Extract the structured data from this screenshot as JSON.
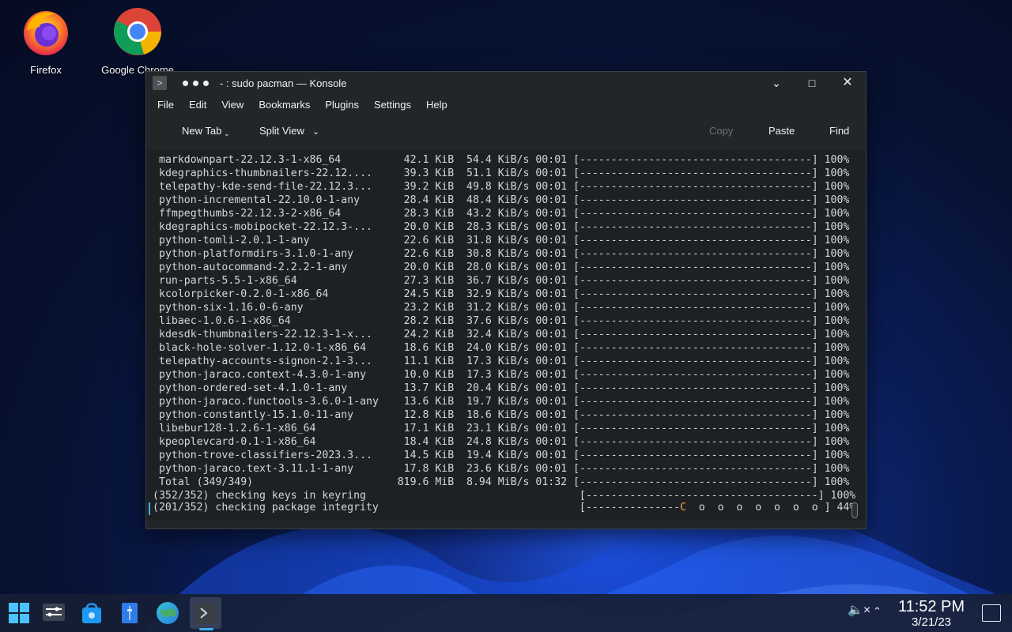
{
  "desktop": {
    "icons": [
      {
        "label": "Firefox"
      },
      {
        "label": "Google Chrome"
      }
    ]
  },
  "window": {
    "title": "- : sudo pacman — Konsole",
    "menu": [
      "File",
      "Edit",
      "View",
      "Bookmarks",
      "Plugins",
      "Settings",
      "Help"
    ],
    "toolbar": {
      "new_tab": "New Tab",
      "split_view": "Split View",
      "copy": "Copy",
      "paste": "Paste",
      "find": "Find"
    }
  },
  "terminal": {
    "lines": [
      "markdownpart-22.12.3-1-x86_64          42.1 KiB  54.4 KiB/s 00:01 [-------------------------------------] 100%",
      "kdegraphics-thumbnailers-22.12....     39.3 KiB  51.1 KiB/s 00:01 [-------------------------------------] 100%",
      "telepathy-kde-send-file-22.12.3...     39.2 KiB  49.8 KiB/s 00:01 [-------------------------------------] 100%",
      "python-incremental-22.10.0-1-any       28.4 KiB  48.4 KiB/s 00:01 [-------------------------------------] 100%",
      "ffmpegthumbs-22.12.3-2-x86_64          28.3 KiB  43.2 KiB/s 00:01 [-------------------------------------] 100%",
      "kdegraphics-mobipocket-22.12.3-...     20.0 KiB  28.3 KiB/s 00:01 [-------------------------------------] 100%",
      "python-tomli-2.0.1-1-any               22.6 KiB  31.8 KiB/s 00:01 [-------------------------------------] 100%",
      "python-platformdirs-3.1.0-1-any        22.6 KiB  30.8 KiB/s 00:01 [-------------------------------------] 100%",
      "python-autocommand-2.2.2-1-any         20.0 KiB  28.0 KiB/s 00:01 [-------------------------------------] 100%",
      "run-parts-5.5-1-x86_64                 27.3 KiB  36.7 KiB/s 00:01 [-------------------------------------] 100%",
      "kcolorpicker-0.2.0-1-x86_64            24.5 KiB  32.9 KiB/s 00:01 [-------------------------------------] 100%",
      "python-six-1.16.0-6-any                23.2 KiB  31.2 KiB/s 00:01 [-------------------------------------] 100%",
      "libaec-1.0.6-1-x86_64                  28.2 KiB  37.6 KiB/s 00:01 [-------------------------------------] 100%",
      "kdesdk-thumbnailers-22.12.3-1-x...     24.2 KiB  32.4 KiB/s 00:01 [-------------------------------------] 100%",
      "black-hole-solver-1.12.0-1-x86_64      18.6 KiB  24.0 KiB/s 00:01 [-------------------------------------] 100%",
      "telepathy-accounts-signon-2.1-3...     11.1 KiB  17.3 KiB/s 00:01 [-------------------------------------] 100%",
      "python-jaraco.context-4.3.0-1-any      10.0 KiB  17.3 KiB/s 00:01 [-------------------------------------] 100%",
      "python-ordered-set-4.1.0-1-any         13.7 KiB  20.4 KiB/s 00:01 [-------------------------------------] 100%",
      "python-jaraco.functools-3.6.0-1-any    13.6 KiB  19.7 KiB/s 00:01 [-------------------------------------] 100%",
      "python-constantly-15.1.0-11-any        12.8 KiB  18.6 KiB/s 00:01 [-------------------------------------] 100%",
      "libebur128-1.2.6-1-x86_64              17.1 KiB  23.1 KiB/s 00:01 [-------------------------------------] 100%",
      "kpeoplevcard-0.1-1-x86_64              18.4 KiB  24.8 KiB/s 00:01 [-------------------------------------] 100%",
      "python-trove-classifiers-2023.3...     14.5 KiB  19.4 KiB/s 00:01 [-------------------------------------] 100%",
      "python-jaraco.text-3.11.1-1-any        17.8 KiB  23.6 KiB/s 00:01 [-------------------------------------] 100%",
      "Total (349/349)                       819.6 MiB  8.94 MiB/s 01:32 [-------------------------------------] 100%",
      "(352/352) checking keys in keyring                                  [-------------------------------------] 100%"
    ],
    "last_line": {
      "text": "(201/352) checking package integrity",
      "bar_open": "[",
      "bar_done": "---------------",
      "pacman": "C",
      "bar_rest": "  o  o  o  o  o  o  o ]",
      "percent": " 44%"
    },
    "colors": {
      "pacman": "#f0a34d",
      "accent": "#3daee9"
    }
  },
  "taskbar": {
    "apps": [
      "start-menu-icon",
      "system-settings-icon",
      "discover-store-icon",
      "dolphin-files-icon",
      "browser-globe-icon",
      "konsole-icon"
    ],
    "clock": {
      "time": "11:52 PM",
      "date": "3/21/23"
    }
  }
}
